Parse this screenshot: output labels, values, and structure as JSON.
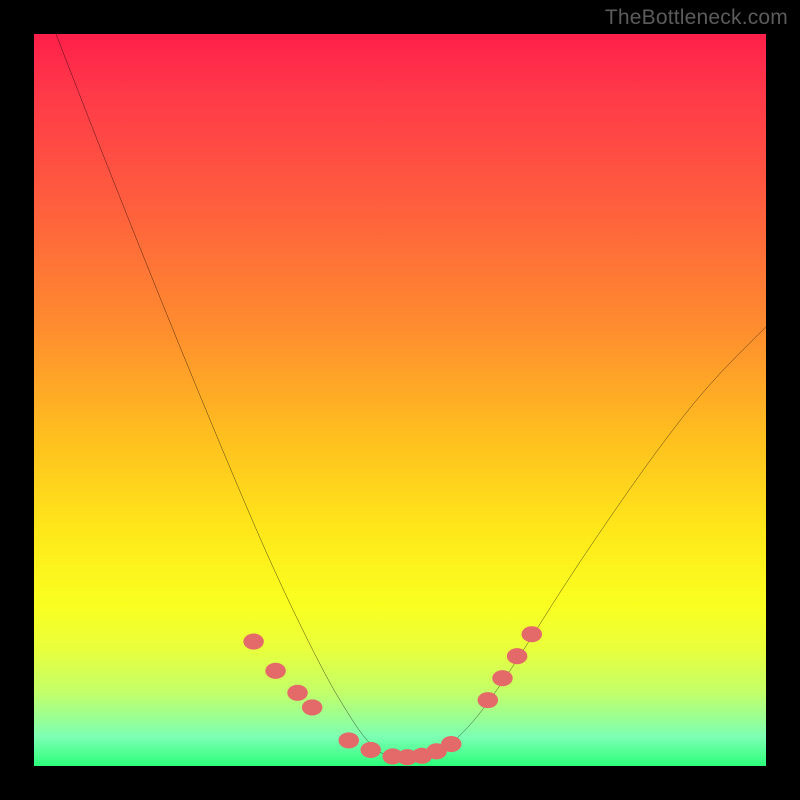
{
  "attribution": "TheBottleneck.com",
  "colors": {
    "frame": "#000000",
    "curve": "#000000",
    "markers": "#e46a6a",
    "gradient_top": "#ff1f4a",
    "gradient_bottom": "#2bff7a"
  },
  "chart_data": {
    "type": "line",
    "title": "",
    "xlabel": "",
    "ylabel": "",
    "xlim": [
      0,
      100
    ],
    "ylim": [
      0,
      100
    ],
    "series": [
      {
        "name": "bottleneck-curve",
        "x": [
          3,
          10,
          20,
          30,
          35,
          40,
          43,
          45,
          47,
          49,
          51,
          53,
          55,
          57,
          60,
          63,
          67,
          72,
          78,
          85,
          92,
          100
        ],
        "y": [
          100,
          82,
          57,
          33,
          22,
          12,
          7,
          4,
          2,
          1,
          1,
          1,
          2,
          3,
          6,
          10,
          16,
          24,
          33,
          43,
          52,
          60
        ]
      }
    ],
    "markers": [
      {
        "name": "left-cluster",
        "x": [
          30,
          33,
          36,
          38
        ],
        "y": [
          17,
          13,
          10,
          8
        ]
      },
      {
        "name": "valley-floor",
        "x": [
          43,
          46,
          49,
          51,
          53,
          55,
          57
        ],
        "y": [
          3.5,
          2.2,
          1.3,
          1.2,
          1.4,
          2.0,
          3.0
        ]
      },
      {
        "name": "right-cluster",
        "x": [
          62,
          64,
          66,
          68
        ],
        "y": [
          9,
          12,
          15,
          18
        ]
      }
    ],
    "grid": false,
    "legend": false
  }
}
